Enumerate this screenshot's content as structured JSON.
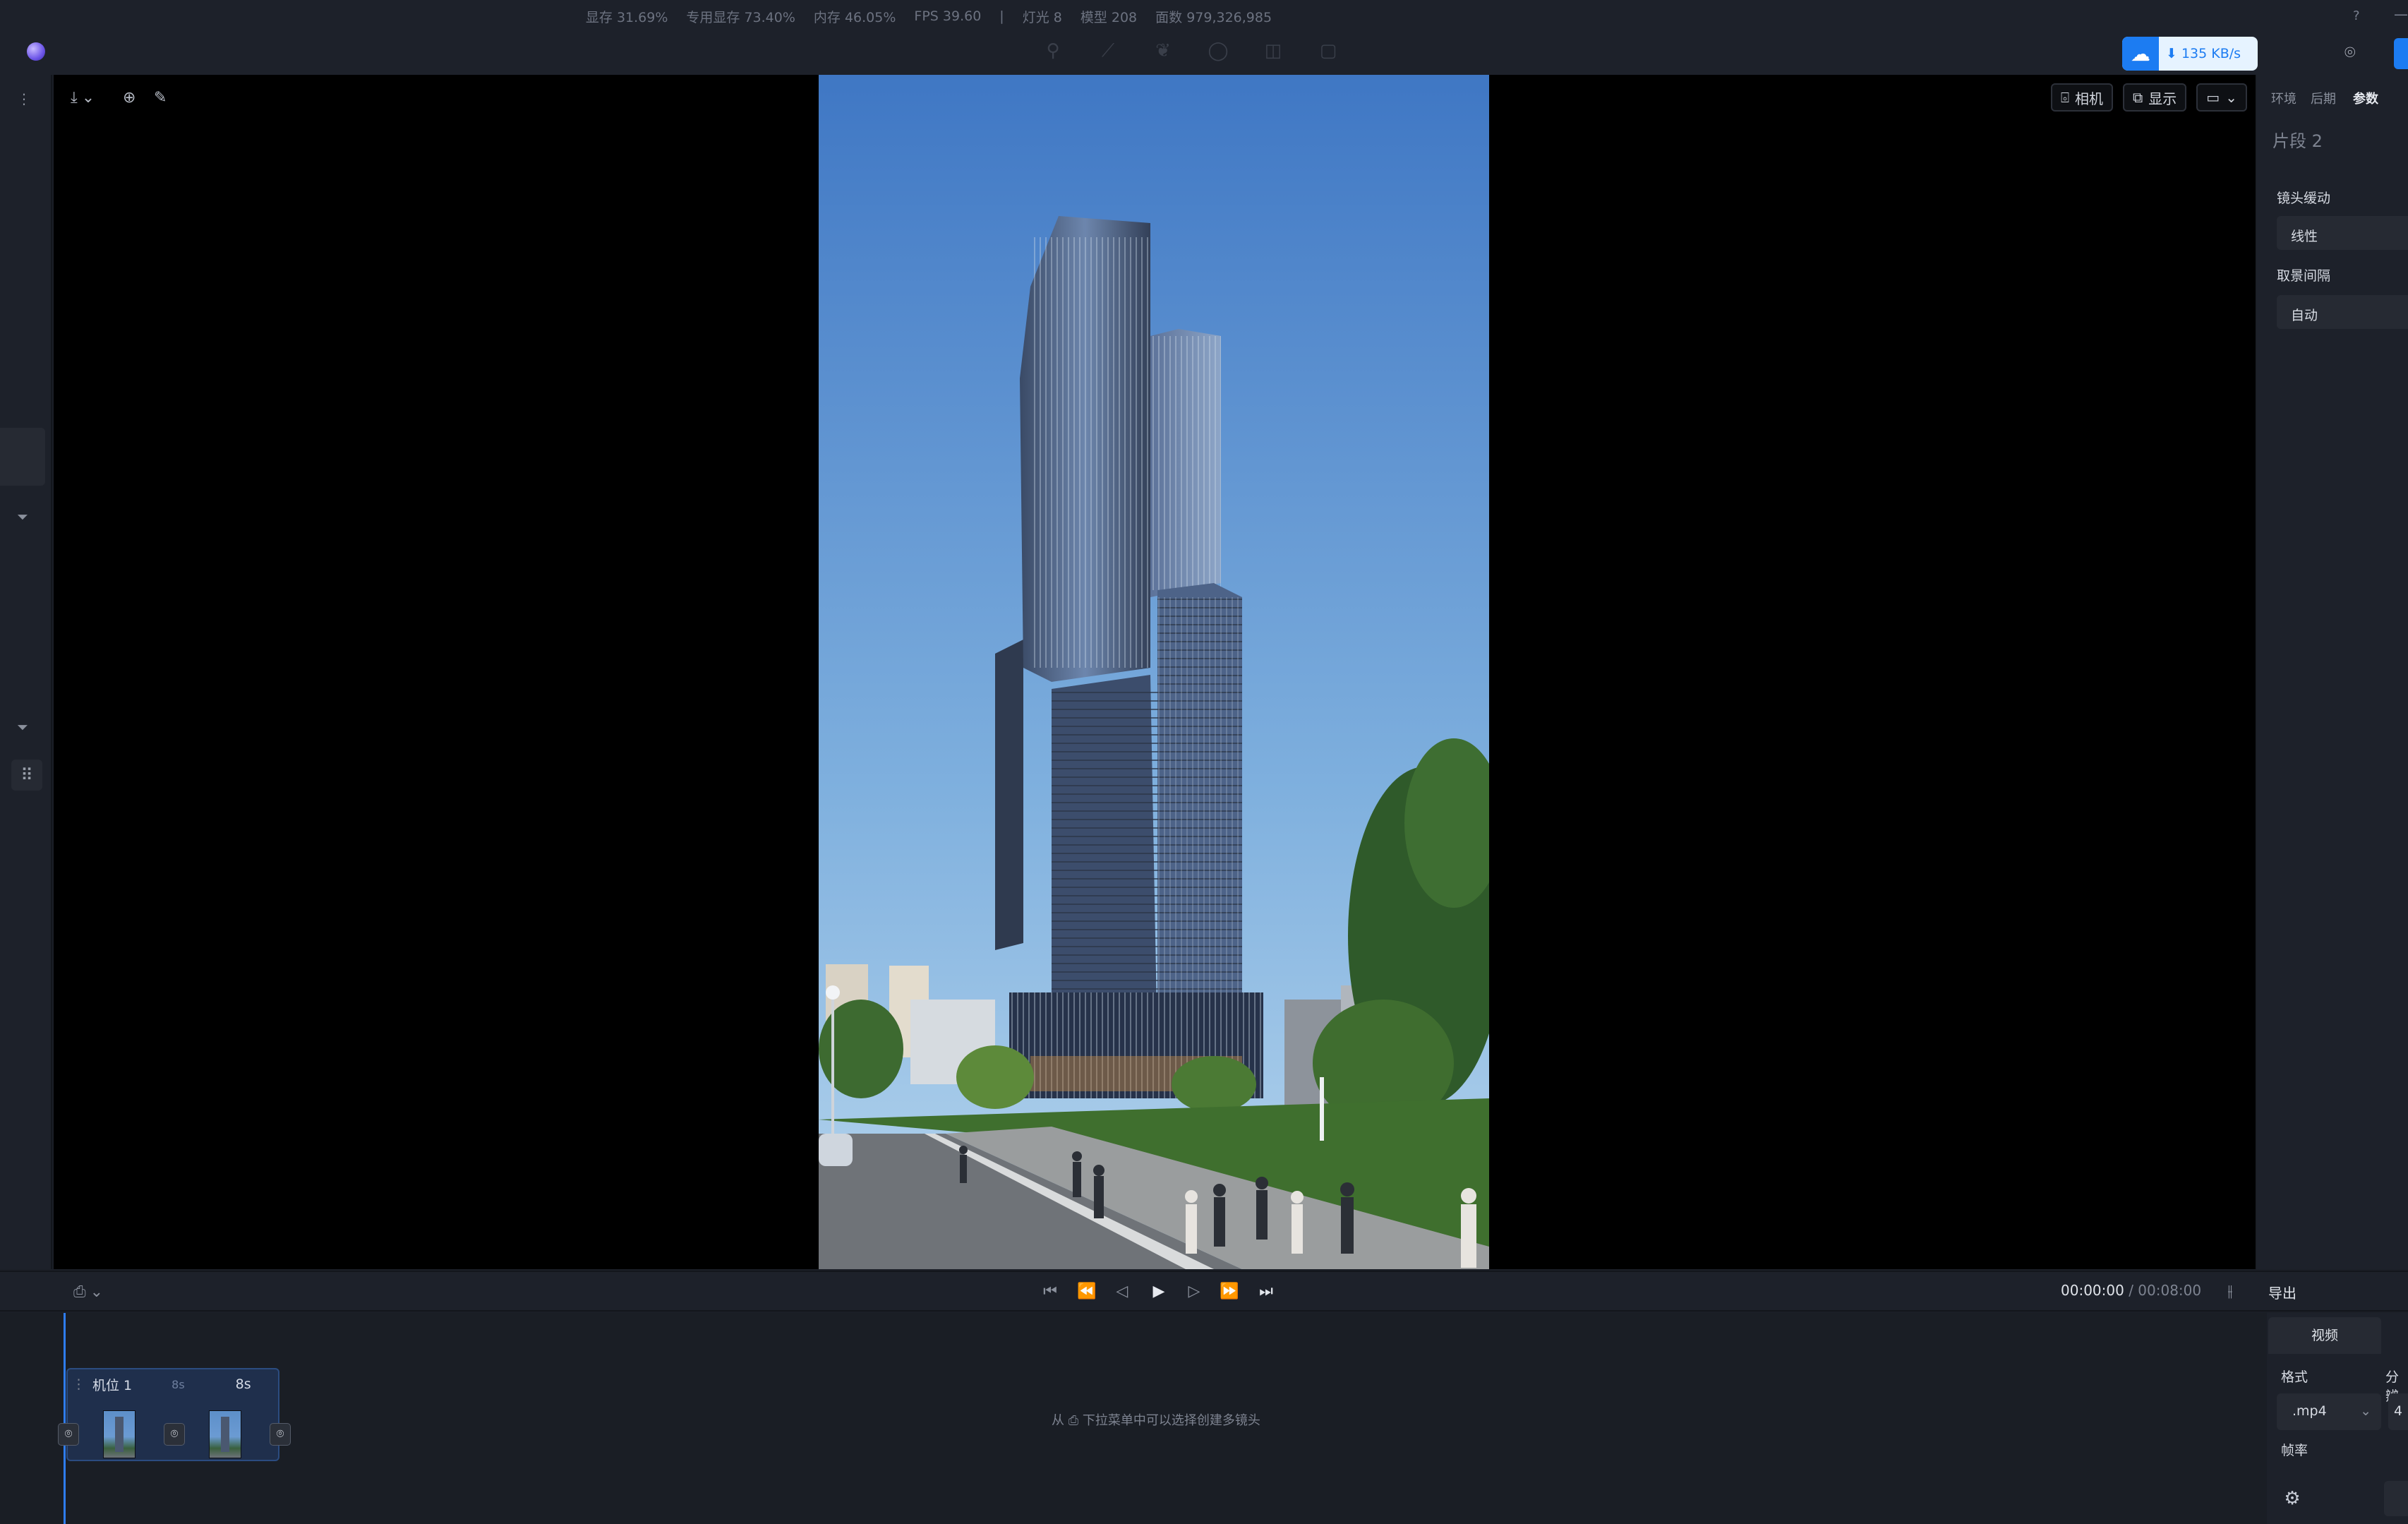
{
  "stats": {
    "vram": "显存 31.69%",
    "dedicated_vram": "专用显存 73.40%",
    "memory": "内存 46.05%",
    "fps": "FPS 39.60",
    "divider": "|",
    "lights": "灯光 8",
    "models": "模型 208",
    "faces": "面数 979,326,985"
  },
  "download": {
    "speed": "135 KB/s"
  },
  "viewport": {
    "camera_btn": "相机",
    "display_btn": "显示"
  },
  "right_panel": {
    "tabs": [
      "环境",
      "后期",
      "参数"
    ],
    "segment": "片段 2",
    "lens_ease_label": "镜头缓动",
    "lens_ease_value": "线性",
    "frame_interval_label": "取景间隔",
    "frame_interval_value": "自动"
  },
  "transport": {
    "current": "00:00:00",
    "separator": "/",
    "duration": "00:08:00"
  },
  "export": {
    "title": "导出",
    "tab": "视频",
    "format_label": "格式",
    "format_value": ".mp4",
    "resolution_label": "分辨",
    "resolution_value": "4",
    "framerate_label": "帧率"
  },
  "timeline": {
    "clip_name": "机位 1",
    "clip_dur1": "8s",
    "clip_dur2": "8s",
    "hint_prefix": "从",
    "hint_suffix": "下拉菜单中可以选择创建多镜头"
  },
  "colors": {
    "accent": "#1c7cf2",
    "sky_top": "#3f77c4",
    "sky_bottom": "#a9cde9"
  }
}
